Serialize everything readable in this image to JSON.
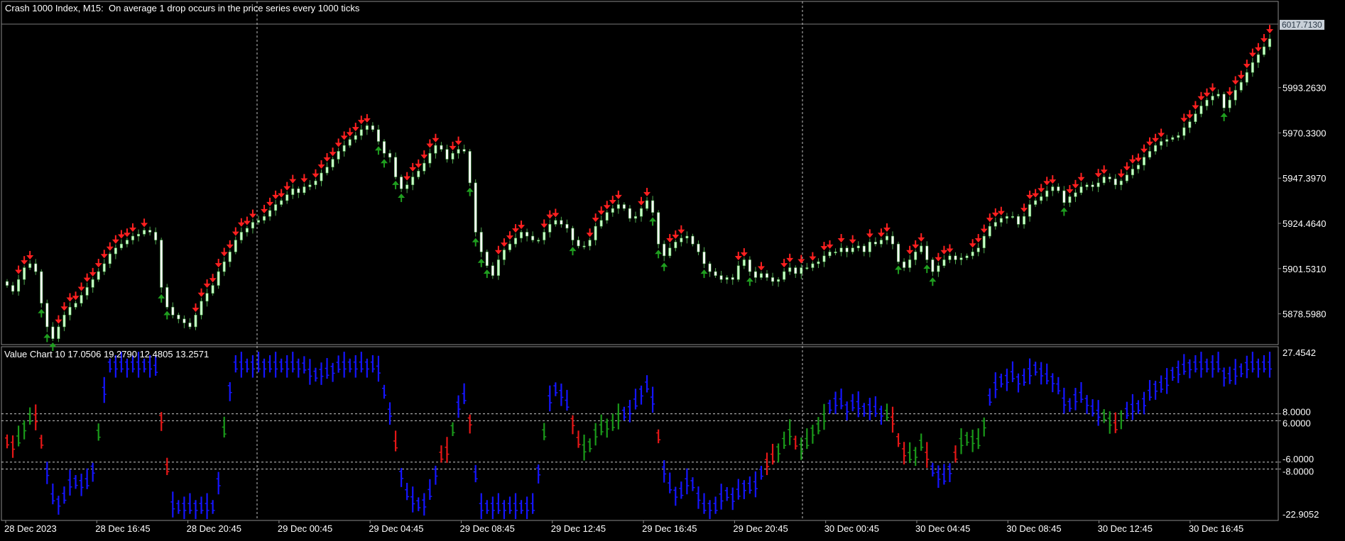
{
  "main_title": "Crash 1000 Index, M15:  On average 1 drop occurs in the price series every 1000 ticks",
  "indicator_title": "Value Chart 10 17.0506 19.2790 12.4805 13.2571",
  "current_price": "6017.7130",
  "price_axis": {
    "labels": [
      "5993.2630",
      "5970.3300",
      "5947.3970",
      "5924.4640",
      "5901.5310",
      "5878.5980"
    ],
    "values": [
      5993.263,
      5970.33,
      5947.397,
      5924.464,
      5901.531,
      5878.598
    ],
    "range": [
      5863.0,
      6037.0
    ]
  },
  "indicator_axis": {
    "top_label": "27.4542",
    "bottom_label": "-22.9052",
    "range": [
      -22.9052,
      27.4542
    ],
    "level_labels": [
      "8.0000",
      "6.0000",
      "-6.0000",
      "-8.0000"
    ],
    "levels": [
      8,
      6,
      -6,
      -8
    ]
  },
  "time_axis": {
    "labels": [
      "28 Dec 2023",
      "28 Dec 16:45",
      "28 Dec 20:45",
      "29 Dec 00:45",
      "29 Dec 04:45",
      "29 Dec 08:45",
      "29 Dec 12:45",
      "29 Dec 16:45",
      "29 Dec 20:45",
      "30 Dec 00:45",
      "30 Dec 04:45",
      "30 Dec 08:45",
      "30 Dec 12:45",
      "30 Dec 16:45"
    ]
  },
  "series": {
    "close_path": [
      5893,
      5890,
      5896,
      5902,
      5904,
      5900,
      5884,
      5872,
      5866,
      5872,
      5878,
      5882,
      5884,
      5888,
      5892,
      5896,
      5900,
      5904,
      5909,
      5912,
      5914,
      5916,
      5918,
      5919,
      5921,
      5920,
      5916,
      5892,
      5882,
      5878,
      5876,
      5874,
      5872,
      5878,
      5885,
      5889,
      5893,
      5900,
      5905,
      5910,
      5916,
      5920,
      5922,
      5925,
      5926,
      5928,
      5931,
      5934,
      5936,
      5939,
      5942,
      5940,
      5943,
      5944,
      5946,
      5950,
      5953,
      5957,
      5961,
      5964,
      5967,
      5969,
      5972,
      5974,
      5972,
      5966,
      5960,
      5958,
      5948,
      5942,
      5944,
      5948,
      5951,
      5955,
      5960,
      5964,
      5962,
      5957,
      5960,
      5962,
      5961,
      5945,
      5920,
      5910,
      5903,
      5898,
      5906,
      5911,
      5914,
      5917,
      5920,
      5918,
      5916,
      5916,
      5920,
      5924,
      5926,
      5924,
      5922,
      5916,
      5913,
      5913,
      5916,
      5923,
      5926,
      5930,
      5932,
      5934,
      5932,
      5927,
      5928,
      5932,
      5936,
      5930,
      5914,
      5908,
      5912,
      5915,
      5917,
      5918,
      5914,
      5910,
      5904,
      5900,
      5898,
      5896,
      5897,
      5896,
      5903,
      5906,
      5900,
      5897,
      5899,
      5897,
      5895,
      5896,
      5900,
      5902,
      5899,
      5902,
      5902,
      5904,
      5905,
      5908,
      5910,
      5910,
      5912,
      5910,
      5912,
      5913,
      5910,
      5915,
      5914,
      5916,
      5918,
      5914,
      5905,
      5902,
      5906,
      5910,
      5913,
      5906,
      5900,
      5903,
      5906,
      5908,
      5906,
      5907,
      5908,
      5910,
      5912,
      5918,
      5923,
      5925,
      5927,
      5928,
      5928,
      5924,
      5928,
      5934,
      5936,
      5938,
      5941,
      5943,
      5941,
      5935,
      5938,
      5940,
      5943,
      5944,
      5943,
      5945,
      5948,
      5947,
      5944,
      5946,
      5949,
      5952,
      5954,
      5958,
      5961,
      5964,
      5966,
      5967,
      5968,
      5969,
      5973,
      5976,
      5980,
      5984,
      5987,
      5989,
      5990,
      5983,
      5987,
      5992,
      5996,
      6001,
      6006,
      6010,
      6014,
      6018
    ]
  },
  "colors": {
    "bull_candle": "#c8ffc8",
    "bear_candle": "#ffffff",
    "wick": "#4ea64e",
    "down_arrow": "#ff2020",
    "up_arrow": "#1f9e1f",
    "vc_blue": "#1515ff",
    "vc_green": "#1a9a1a",
    "vc_red": "#e61717",
    "grid_line": "#c8c8c8",
    "axis_text": "#ffffff"
  },
  "icons": {
    "sell_signal": "down-arrow-icon",
    "buy_signal": "up-arrow-icon"
  }
}
